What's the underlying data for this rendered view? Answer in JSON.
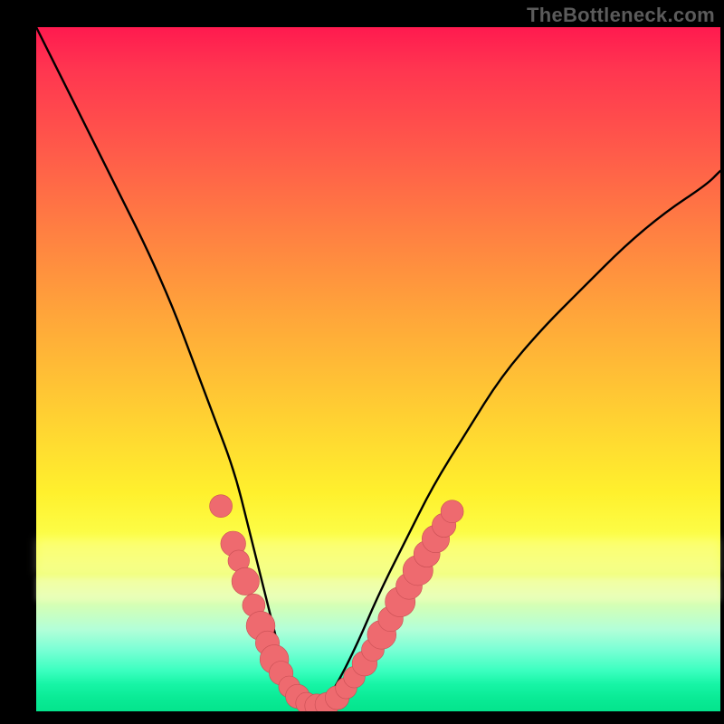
{
  "watermark": "TheBottleneck.com",
  "colors": {
    "frame": "#000000",
    "curve": "#000000",
    "marker_fill": "#ee6a6f",
    "marker_stroke": "#c94f54",
    "gradient_top": "#ff1a4f",
    "gradient_bottom": "#04e48c"
  },
  "chart_data": {
    "type": "line",
    "title": "",
    "xlabel": "",
    "ylabel": "",
    "xlim": [
      0,
      100
    ],
    "ylim": [
      0,
      100
    ],
    "note": "Axes are unlabeled in the image; x and y are normalized 0-100 estimates read from pixel positions. y represents height above the bottom edge of the colored plot area (0 = bottom/green, 100 = top/red). The curve is a V-shaped bottleneck profile.",
    "series": [
      {
        "name": "bottleneck-curve",
        "x": [
          0,
          4,
          8,
          12,
          16,
          20,
          23,
          26,
          29,
          31,
          33,
          35,
          36.5,
          38,
          40,
          42,
          44,
          47,
          50,
          54,
          58,
          63,
          68,
          74,
          80,
          86,
          92,
          98,
          100
        ],
        "y": [
          100,
          92,
          84,
          76,
          68,
          59,
          51,
          43,
          35,
          27,
          19,
          11,
          5,
          1,
          0,
          1,
          4,
          10,
          17,
          25,
          33,
          41,
          49,
          56,
          62,
          68,
          73,
          77,
          79
        ]
      }
    ],
    "markers": {
      "name": "highlighted-points",
      "note": "Pink bead markers clustered near the trough on both arms of the V.",
      "points": [
        {
          "x": 27.0,
          "y": 30.0,
          "r": 1.1
        },
        {
          "x": 28.8,
          "y": 24.5,
          "r": 1.3
        },
        {
          "x": 29.6,
          "y": 22.0,
          "r": 1.0
        },
        {
          "x": 30.6,
          "y": 19.0,
          "r": 1.5
        },
        {
          "x": 31.8,
          "y": 15.5,
          "r": 1.1
        },
        {
          "x": 32.8,
          "y": 12.5,
          "r": 1.6
        },
        {
          "x": 33.8,
          "y": 10.0,
          "r": 1.2
        },
        {
          "x": 34.8,
          "y": 7.6,
          "r": 1.6
        },
        {
          "x": 35.8,
          "y": 5.6,
          "r": 1.2
        },
        {
          "x": 37.0,
          "y": 3.6,
          "r": 1.0
        },
        {
          "x": 38.2,
          "y": 2.2,
          "r": 1.2
        },
        {
          "x": 39.5,
          "y": 1.2,
          "r": 1.0
        },
        {
          "x": 41.0,
          "y": 0.8,
          "r": 1.2
        },
        {
          "x": 42.5,
          "y": 1.0,
          "r": 1.2
        },
        {
          "x": 44.0,
          "y": 2.0,
          "r": 1.2
        },
        {
          "x": 45.3,
          "y": 3.4,
          "r": 1.0
        },
        {
          "x": 46.5,
          "y": 5.0,
          "r": 1.0
        },
        {
          "x": 48.0,
          "y": 7.0,
          "r": 1.3
        },
        {
          "x": 49.2,
          "y": 9.0,
          "r": 1.1
        },
        {
          "x": 50.5,
          "y": 11.2,
          "r": 1.6
        },
        {
          "x": 51.8,
          "y": 13.5,
          "r": 1.3
        },
        {
          "x": 53.2,
          "y": 16.0,
          "r": 1.7
        },
        {
          "x": 54.5,
          "y": 18.3,
          "r": 1.4
        },
        {
          "x": 55.8,
          "y": 20.6,
          "r": 1.7
        },
        {
          "x": 57.1,
          "y": 23.0,
          "r": 1.4
        },
        {
          "x": 58.4,
          "y": 25.2,
          "r": 1.5
        },
        {
          "x": 59.6,
          "y": 27.2,
          "r": 1.2
        },
        {
          "x": 60.8,
          "y": 29.2,
          "r": 1.1
        }
      ]
    }
  }
}
